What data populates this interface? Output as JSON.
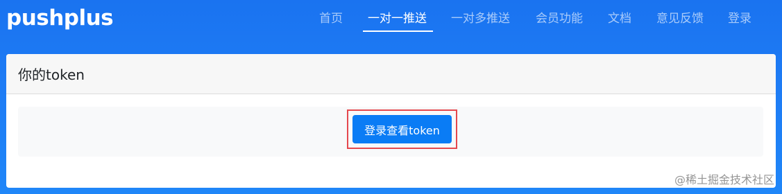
{
  "navbar": {
    "brand": "pushplus",
    "items": [
      {
        "label": "首页",
        "active": false
      },
      {
        "label": "一对一推送",
        "active": true
      },
      {
        "label": "一对多推送",
        "active": false
      },
      {
        "label": "会员功能",
        "active": false
      },
      {
        "label": "文档",
        "active": false
      },
      {
        "label": "意见反馈",
        "active": false
      },
      {
        "label": "登录",
        "active": false
      }
    ]
  },
  "card": {
    "title": "你的token",
    "button_label": "登录查看token"
  },
  "watermark": "@稀土掘金技术社区",
  "colors": {
    "background": "#1a73f0",
    "button": "#0a7cf5",
    "highlight": "#e5484d"
  }
}
